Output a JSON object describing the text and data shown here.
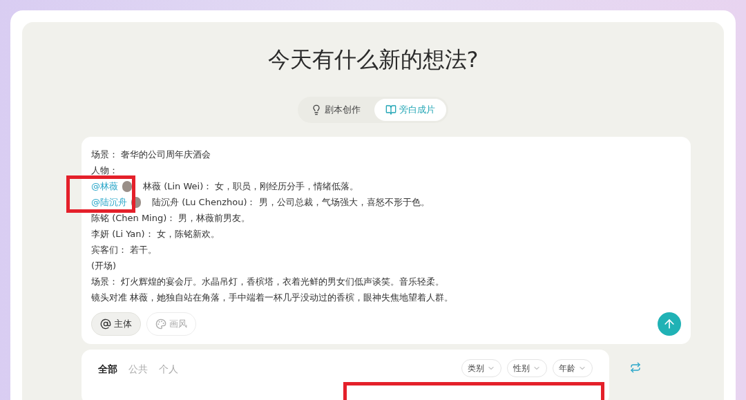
{
  "title": "今天有什么新的想法?",
  "modes": [
    {
      "label": "剧本创作",
      "selected": false
    },
    {
      "label": "旁白成片",
      "selected": true
    }
  ],
  "script_lines": [
    {
      "kind": "plain",
      "text": "场景： 奢华的公司周年庆酒会"
    },
    {
      "kind": "plain",
      "text": "人物："
    },
    {
      "kind": "mention",
      "mention": "@林薇",
      "text": "林薇 (Lin Wei)： 女，职员，刚经历分手，情绪低落。"
    },
    {
      "kind": "mention",
      "mention": "@陆沉舟",
      "text": "陆沉舟 (Lu Chenzhou)： 男，公司总裁，气场强大，喜怒不形于色。"
    },
    {
      "kind": "plain",
      "text": "陈铭 (Chen Ming)： 男，林薇前男友。"
    },
    {
      "kind": "plain",
      "text": "李妍 (Li Yan)： 女，陈铭新欢。"
    },
    {
      "kind": "plain",
      "text": "宾客们： 若干。"
    },
    {
      "kind": "plain",
      "text": "(开场)"
    },
    {
      "kind": "plain",
      "text": "场景： 灯火辉煌的宴会厅。水晶吊灯，香槟塔，衣着光鲜的男女们低声谈笑。音乐轻柔。"
    },
    {
      "kind": "plain",
      "text": "镜头对准 林薇，她独自站在角落，手中端着一杯几乎没动过的香槟，眼神失焦地望着人群。"
    }
  ],
  "chips": [
    {
      "label": "主体",
      "selected": true
    },
    {
      "label": "画风",
      "selected": false
    }
  ],
  "library": {
    "tabs": [
      {
        "label": "全部",
        "selected": true
      },
      {
        "label": "公共",
        "selected": false
      },
      {
        "label": "个人",
        "selected": false
      }
    ],
    "filters": [
      "类别",
      "性别",
      "年龄"
    ]
  }
}
